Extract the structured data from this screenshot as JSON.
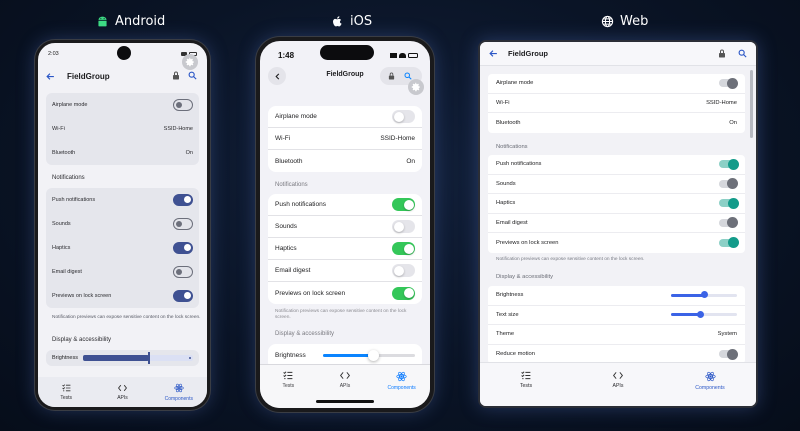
{
  "platforms": {
    "android": "Android",
    "ios": "iOS",
    "web": "Web"
  },
  "icons": {
    "android_logo": "android-robot-icon",
    "ios_logo": "apple-icon",
    "web_logo": "globe-icon",
    "back": "arrow-left-icon",
    "lock": "lock-icon",
    "search": "search-icon",
    "gear": "gear-icon",
    "tests": "checklist-icon",
    "apis": "code-brackets-icon",
    "components": "react-atom-icon"
  },
  "colors": {
    "android_accent": "#3f5192",
    "ios_accent": "#34c759",
    "ios_link": "#0a84ff",
    "web_accent": "#139b8a",
    "web_link": "#3b63e6"
  },
  "android": {
    "status_time": "2:03",
    "app_title": "FieldGroup",
    "rows": {
      "airplane": "Airplane mode",
      "wifi": "Wi-Fi",
      "wifi_value": "SSID-Home",
      "bluetooth": "Bluetooth",
      "bluetooth_value": "On"
    },
    "section_notifications": "Notifications",
    "notif": {
      "push": "Push notifications",
      "sounds": "Sounds",
      "haptics": "Haptics",
      "email": "Email digest",
      "previews": "Previews on lock screen"
    },
    "note": "Notification previews can expose sensitive content on the lock screen.",
    "section_display": "Display & accessibility",
    "brightness": "Brightness",
    "brightness_level": 0.6,
    "nav": {
      "tests": "Tests",
      "apis": "APIs",
      "components": "Components"
    }
  },
  "ios": {
    "status_time": "1:48",
    "app_title": "FieldGroup",
    "rows": {
      "airplane": "Airplane mode",
      "wifi": "Wi-Fi",
      "wifi_value": "SSID-Home",
      "bluetooth": "Bluetooth",
      "bluetooth_value": "On"
    },
    "section_notifications": "Notifications",
    "notif": {
      "push": "Push notifications",
      "sounds": "Sounds",
      "haptics": "Haptics",
      "email": "Email digest",
      "previews": "Previews on lock screen"
    },
    "note": "Notification previews can expose sensitive content on the lock screen.",
    "section_display": "Display & accessibility",
    "brightness": "Brightness",
    "brightness_level": 0.55,
    "nav": {
      "tests": "Tests",
      "apis": "APIs",
      "components": "Components"
    }
  },
  "web": {
    "app_title": "FieldGroup",
    "rows": {
      "airplane": "Airplane mode",
      "wifi": "Wi-Fi",
      "wifi_value": "SSID-Home",
      "bluetooth": "Bluetooth",
      "bluetooth_value": "On"
    },
    "section_notifications": "Notifications",
    "notif": {
      "push": "Push notifications",
      "sounds": "Sounds",
      "haptics": "Haptics",
      "email": "Email digest",
      "previews": "Previews on lock screen"
    },
    "note": "Notification previews can expose sensitive content on the lock screen.",
    "section_display": "Display & accessibility",
    "brightness": "Brightness",
    "brightness_level": 0.5,
    "text_size": "Text size",
    "text_size_level": 0.45,
    "theme": "Theme",
    "theme_value": "System",
    "reduce_motion": "Reduce motion",
    "nav": {
      "tests": "Tests",
      "apis": "APIs",
      "components": "Components"
    }
  }
}
